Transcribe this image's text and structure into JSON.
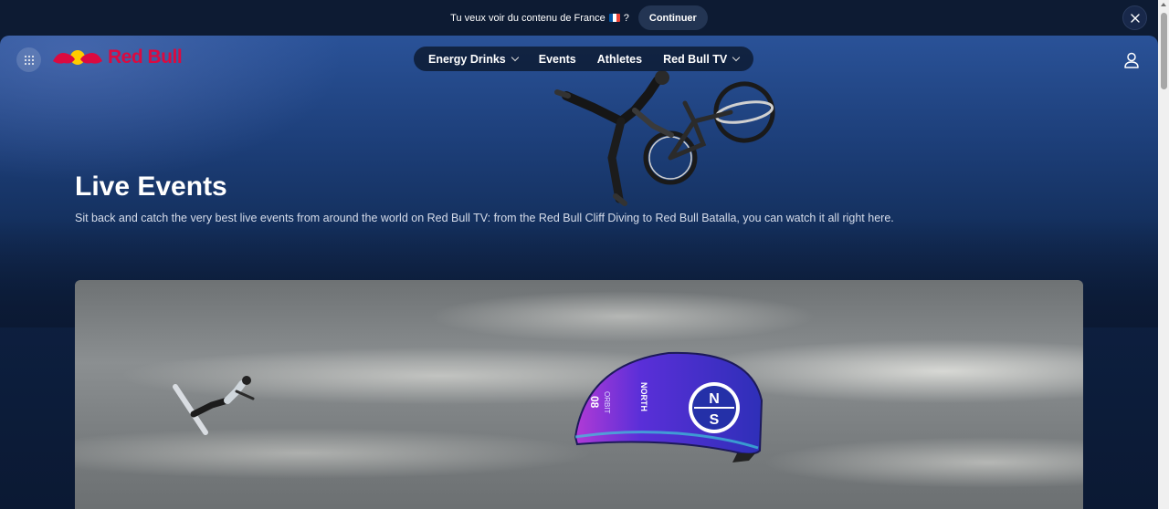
{
  "banner": {
    "text": "Tu veux voir du contenu de France",
    "flag": "flag-france-icon",
    "question_mark": "?",
    "continue_label": "Continuer",
    "close_icon": "close-icon"
  },
  "header": {
    "apps_icon": "grid-icon",
    "logo_text": "Red Bull",
    "nav": [
      {
        "label": "Energy Drinks",
        "has_dropdown": true
      },
      {
        "label": "Events",
        "has_dropdown": false
      },
      {
        "label": "Athletes",
        "has_dropdown": false
      },
      {
        "label": "Red Bull TV",
        "has_dropdown": true
      }
    ],
    "user_icon": "user-icon"
  },
  "hero": {
    "title": "Live Events",
    "subtitle": "Sit back and catch the very best live events from around the world on Red Bull TV: from the Red Bull Cliff Diving to Red Bull Batalla, you can watch it all right here."
  },
  "card": {
    "kite_brand": "NORTH",
    "kite_model": "ORBIT",
    "kite_size": "08",
    "kite_logo": "NS"
  },
  "colors": {
    "brand_red": "#db0a40",
    "page_bg": "#0d1b33"
  }
}
